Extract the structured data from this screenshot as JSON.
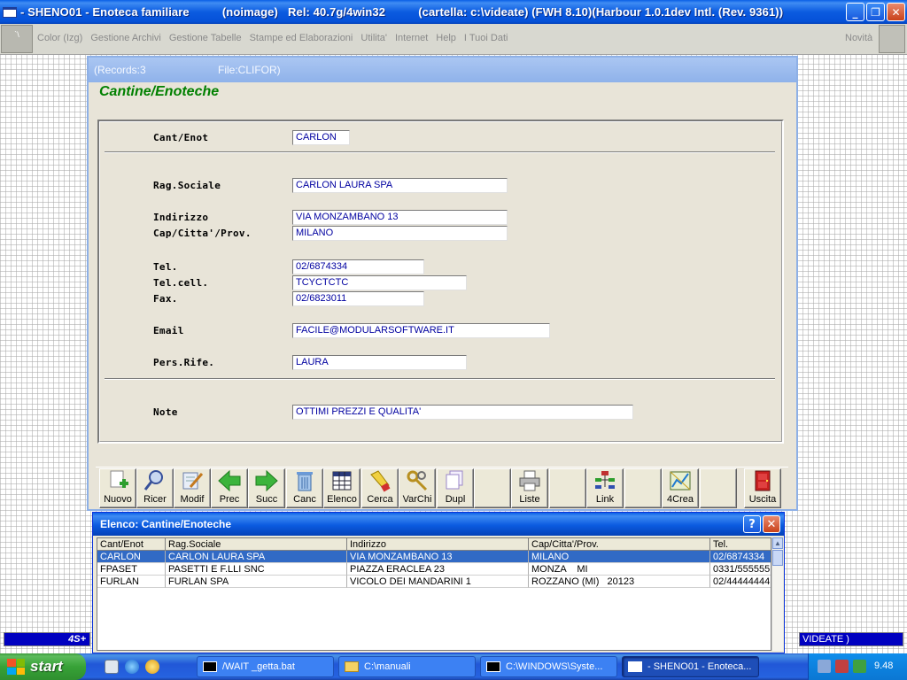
{
  "window": {
    "title": "- SHENO01 - Enoteca familiare          (noimage)   Rel: 40.7g/4win32          (cartella: c:\\videate) (FWH 8.10)(Harbour 1.0.1dev Intl. (Rev. 9361))",
    "minimize": "_",
    "restore": "❐",
    "close": "✕"
  },
  "menu": {
    "items": [
      "Color (Izg)",
      "Gestione Archivi",
      "Gestione Tabelle",
      "Stampe ed Elaborazioni",
      "Utilita'",
      "Internet",
      "Help",
      "I Tuoi Dati"
    ],
    "right": "Novità"
  },
  "form": {
    "records": "(Records:3",
    "file": "File:CLIFOR)",
    "title": "Cantine/Enoteche",
    "fields": {
      "cant_enot": {
        "label": "Cant/Enot",
        "value": "CARLON"
      },
      "rag_sociale": {
        "label": "Rag.Sociale",
        "value": "CARLON LAURA SPA"
      },
      "indirizzo": {
        "label": "Indirizzo",
        "value": "VIA MONZAMBANO 13"
      },
      "cap_citta": {
        "label": "Cap/Citta'/Prov.",
        "value": "MILANO"
      },
      "tel": {
        "label": "Tel.",
        "value": "02/6874334"
      },
      "tel_cell": {
        "label": "Tel.cell.",
        "value": "TCYCTCTC"
      },
      "fax": {
        "label": "Fax.",
        "value": "02/6823011"
      },
      "email": {
        "label": "Email",
        "value": "FACILE@MODULARSOFTWARE.IT"
      },
      "pers_rife": {
        "label": "Pers.Rife.",
        "value": "LAURA"
      },
      "note": {
        "label": "Note",
        "value": "OTTIMI PREZZI E QUALITA'"
      }
    }
  },
  "toolbar": {
    "nuovo": "Nuovo",
    "ricer": "Ricer",
    "modif": "Modif",
    "prec": "Prec",
    "succ": "Succ",
    "canc": "Canc",
    "elenco": "Elenco",
    "cerca": "Cerca",
    "varchi": "VarChi",
    "dupl": "Dupl",
    "liste": "Liste",
    "link": "Link",
    "crea4": "4Crea",
    "uscita": "Uscita"
  },
  "list": {
    "title": "Elenco: Cantine/Enoteche",
    "help": "?",
    "close": "✕",
    "columns": [
      "Cant/Enot",
      "Rag.Sociale",
      "Indirizzo",
      "Cap/Citta'/Prov.",
      "Tel."
    ],
    "rows": [
      [
        "CARLON",
        "CARLON LAURA SPA",
        "VIA MONZAMBANO 13",
        "MILANO",
        "02/6874334"
      ],
      [
        "FPASET",
        "PASETTI E F.LLI SNC",
        "PIAZZA ERACLEA 23",
        "MONZA    MI",
        "0331/555555"
      ],
      [
        "FURLAN",
        "FURLAN SPA",
        "VICOLO DEI MANDARINI 1",
        "ROZZANO (MI)   20123",
        "02/44444444"
      ]
    ]
  },
  "status": {
    "left": "4S+",
    "right": "VIDEATE )"
  },
  "taskbar": {
    "start": "start",
    "tasks": [
      "/WAIT _getta.bat",
      "C:\\manuali",
      "C:\\WINDOWS\\Syste...",
      "- SHENO01 - Enoteca..."
    ],
    "clock": "9.48"
  },
  "colors": {
    "title_green": "#008000",
    "field_text": "#0000a0",
    "selection": "#316ac5",
    "xp_blue": "#0b5be0"
  }
}
